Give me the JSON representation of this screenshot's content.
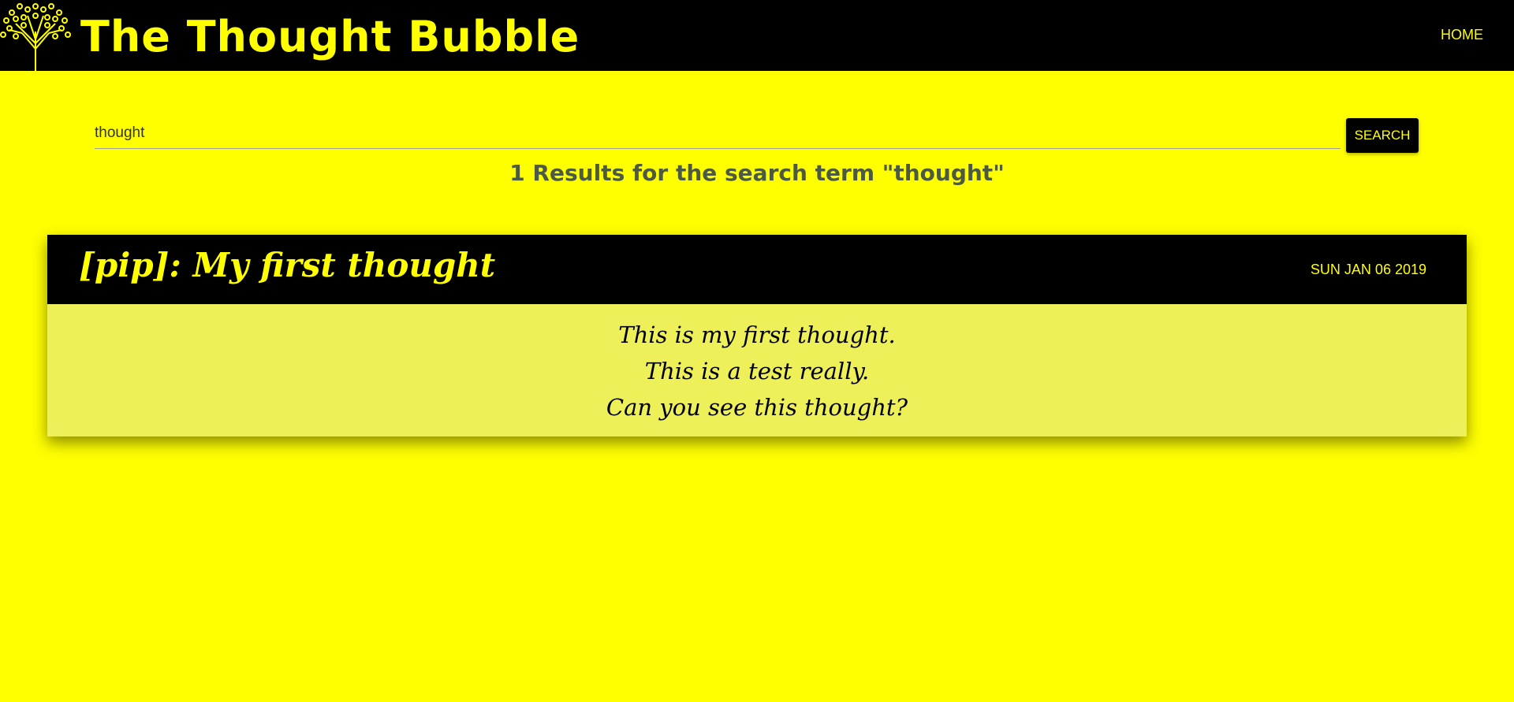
{
  "header": {
    "title": "The Thought Bubble",
    "nav_home": "HOME"
  },
  "search": {
    "value": "thought",
    "button_label": "SEARCH"
  },
  "results": {
    "heading": "1 Results for the search term \"thought\""
  },
  "post": {
    "title": "[pip]: My first thought",
    "date": "SUN JAN 06 2019",
    "lines": [
      "This is my first thought.",
      "This is a test really.",
      "Can you see this thought?"
    ]
  },
  "colors": {
    "background": "#ffff00",
    "navbar": "#000000",
    "accent_text": "#ffff00",
    "card_body": "#eef05a",
    "results_heading": "#4b5a40"
  },
  "icons": {
    "logo": "tree-logo-icon"
  }
}
